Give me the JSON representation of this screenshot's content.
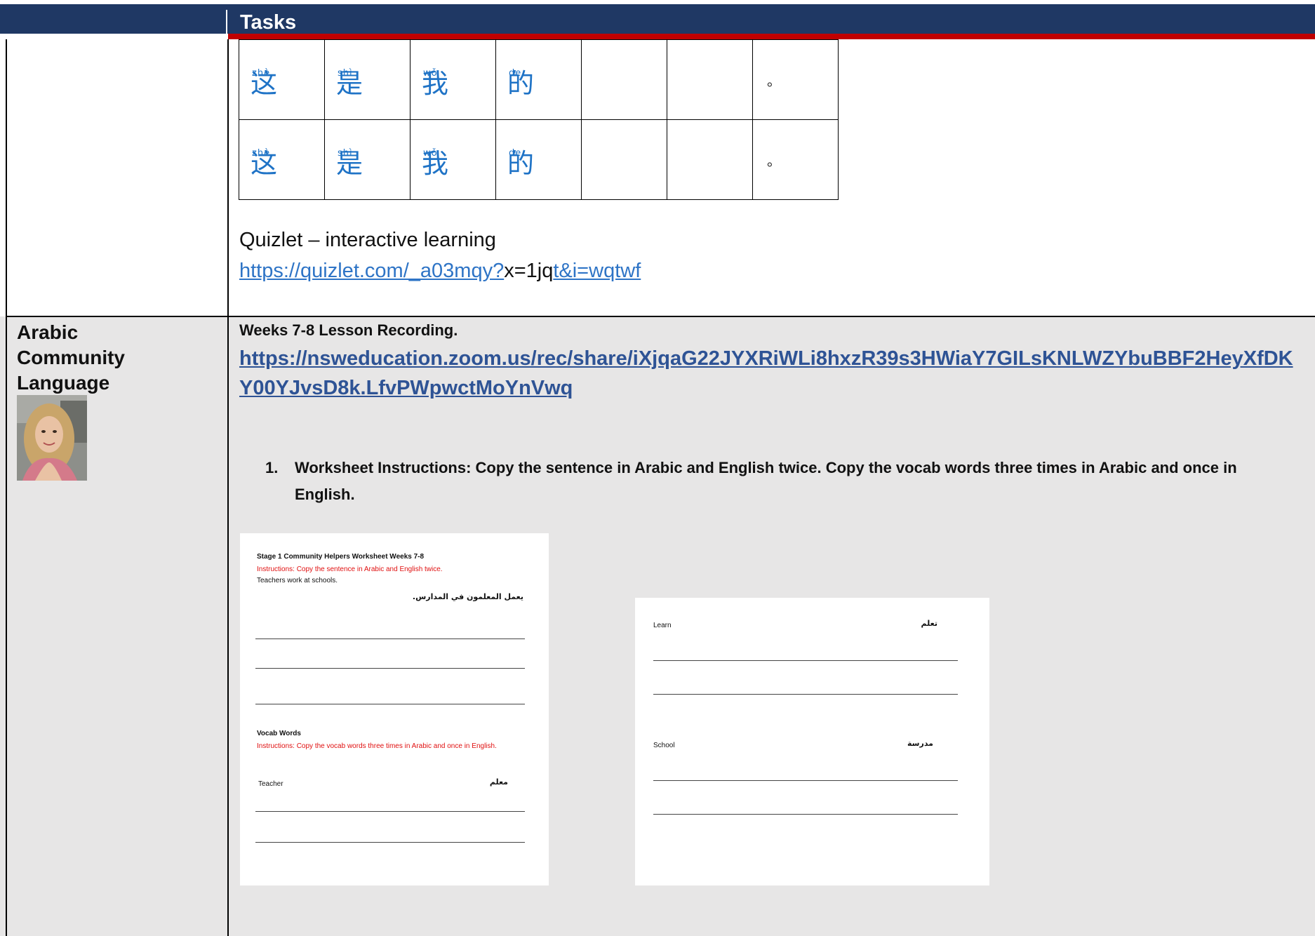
{
  "header": {
    "title": "Tasks"
  },
  "chinese_rows": [
    {
      "chars": [
        {
          "hanzi": "这",
          "pinyin": "zhè"
        },
        {
          "hanzi": "是",
          "pinyin": "shì"
        },
        {
          "hanzi": "我",
          "pinyin": "wǒ"
        },
        {
          "hanzi": "的",
          "pinyin": "de"
        }
      ],
      "end": "。"
    },
    {
      "chars": [
        {
          "hanzi": "这",
          "pinyin": "zhè"
        },
        {
          "hanzi": "是",
          "pinyin": "shì"
        },
        {
          "hanzi": "我",
          "pinyin": "wǒ"
        },
        {
          "hanzi": "的",
          "pinyin": "de"
        }
      ],
      "end": "。"
    }
  ],
  "quizlet": {
    "title": "Quizlet – interactive learning",
    "link_part1": "https://quizlet.com/_a03mqy?",
    "link_part2": "x=1jq",
    "link_part3": "t&i=wqtwf"
  },
  "arabic_section": {
    "subject": "Arabic Community Language",
    "recording_title": "Weeks 7-8 Lesson Recording.",
    "recording_link": "https://nsweducation.zoom.us/rec/share/iXjqaG22JYXRiWLi8hxzR39s3HWiaY7GILsKNLWZYbuBBF2HeyXfDKY00YJvsD8k.LfvPWpwctMoYnVwq",
    "instruction_number": "1.",
    "instruction_text": "Worksheet Instructions: Copy the sentence in Arabic and English twice. Copy the vocab words three times in Arabic and once in English."
  },
  "worksheet1": {
    "title": "Stage 1 Community Helpers Worksheet Weeks 7-8",
    "instr1": "Instructions: Copy the sentence in Arabic and English twice.",
    "sentence_en": "Teachers work at schools.",
    "sentence_ar": "يعمل المعلمون في المدارس.",
    "vocab_title": "Vocab Words",
    "instr2": "Instructions: Copy the vocab words three times in Arabic and once in English.",
    "word_en": "Teacher",
    "word_ar": "معلم"
  },
  "worksheet2": {
    "word1_en": "Learn",
    "word1_ar": "تعلم",
    "word2_en": "School",
    "word2_ar": "مدرسة"
  },
  "colors": {
    "header": "#1f3864",
    "accent_red": "#c00000",
    "link_blue": "#2e5395",
    "hanzi_blue": "#1f73c6"
  }
}
